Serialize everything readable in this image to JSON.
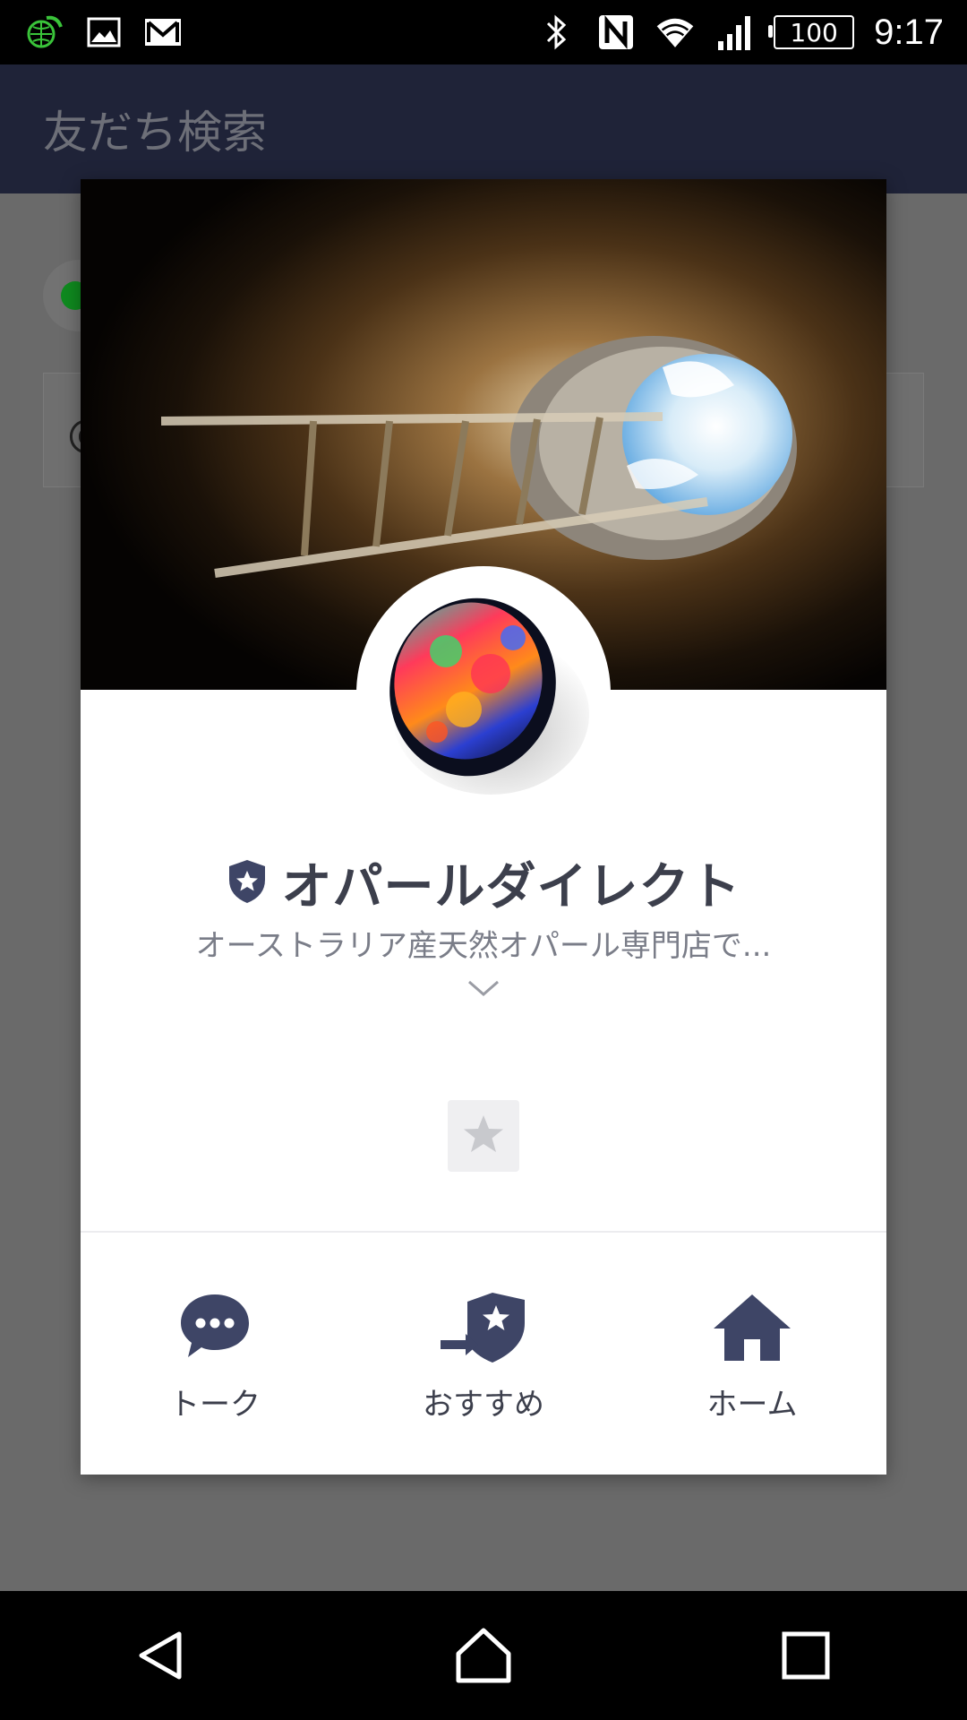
{
  "status_bar": {
    "battery": "100",
    "time": "9:17",
    "left_icons": [
      "globe-icon",
      "image-icon",
      "gmail-icon"
    ],
    "right_icons": [
      "bluetooth-icon",
      "nfc-icon",
      "wifi-icon",
      "signal-icon",
      "battery-icon"
    ]
  },
  "app_bar": {
    "title": "友だち検索"
  },
  "behind": {
    "input_prefix": "@"
  },
  "profile": {
    "name": "オパールダイレクト",
    "description": "オーストラリア産天然オパール専門店で...",
    "badge_icon": "official-shield-star-icon",
    "expand_icon": "chevron-down-icon",
    "favorite_icon": "star-icon"
  },
  "actions": [
    {
      "label": "トーク",
      "icon": "chat-bubble-icon"
    },
    {
      "label": "おすすめ",
      "icon": "recommend-share-icon"
    },
    {
      "label": "ホーム",
      "icon": "home-icon"
    }
  ],
  "colors": {
    "accent": "#3e4566",
    "appbar": "#1f2338",
    "text_dark": "#3c3f4c",
    "text_muted": "#7a7d88"
  }
}
